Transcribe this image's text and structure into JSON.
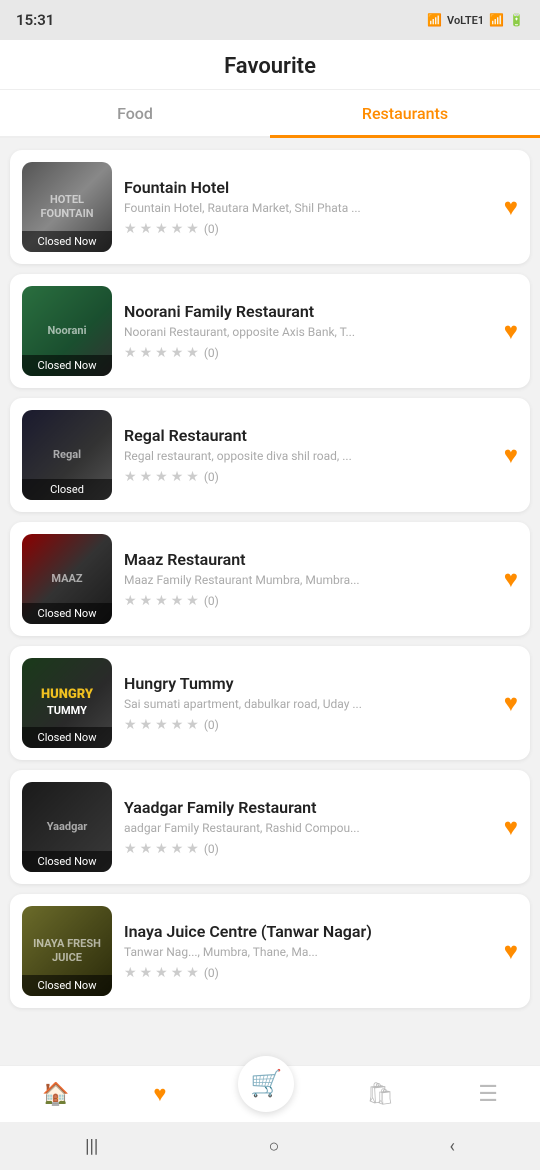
{
  "statusBar": {
    "time": "15:31",
    "icons": "🔔 Vo LTE1 📶 📶 🔋"
  },
  "header": {
    "title": "Favourite"
  },
  "tabs": [
    {
      "id": "food",
      "label": "Food",
      "active": false
    },
    {
      "id": "restaurants",
      "label": "Restaurants",
      "active": true
    }
  ],
  "restaurants": [
    {
      "id": 1,
      "name": "Fountain Hotel",
      "address": "Fountain Hotel, Rautara Market, Shil Phata ...",
      "rating": 0,
      "totalStars": 5,
      "ratingCount": "(0)",
      "status": "Closed Now",
      "imgClass": "img-fountain",
      "imgText": "HOTEL FOUNTAIN"
    },
    {
      "id": 2,
      "name": "Noorani Family Restaurant",
      "address": "Noorani Restaurant, opposite Axis Bank, T...",
      "rating": 0,
      "totalStars": 5,
      "ratingCount": "(0)",
      "status": "Closed Now",
      "imgClass": "img-noorani",
      "imgText": "Noorani"
    },
    {
      "id": 3,
      "name": "Regal Restaurant",
      "address": "Regal restaurant, opposite diva shil road, ...",
      "rating": 0,
      "totalStars": 5,
      "ratingCount": "(0)",
      "status": "Closed",
      "imgClass": "img-regal",
      "imgText": "Regal"
    },
    {
      "id": 4,
      "name": "Maaz Restaurant",
      "address": "Maaz Family Restaurant Mumbra, Mumbra...",
      "rating": 0,
      "totalStars": 5,
      "ratingCount": "(0)",
      "status": "Closed Now",
      "imgClass": "img-maaz",
      "imgText": "MAAZ"
    },
    {
      "id": 5,
      "name": "Hungry Tummy",
      "address": "Sai sumati apartment, dabulkar road, Uday ...",
      "rating": 0,
      "totalStars": 5,
      "ratingCount": "(0)",
      "status": "Closed Now",
      "imgClass": "img-hungry",
      "imgText": "HUNGRY TUMMY"
    },
    {
      "id": 6,
      "name": "Yaadgar Family  Restaurant",
      "address": "aadgar Family Restaurant, Rashid Compou...",
      "rating": 0,
      "totalStars": 5,
      "ratingCount": "(0)",
      "status": "Closed Now",
      "imgClass": "img-yaadgar",
      "imgText": "Yaadgar"
    },
    {
      "id": 7,
      "name": "Inaya Juice Centre (Tanwar Nagar)",
      "address": "Tanwar Nag..., Mumbra, Thane, Ma...",
      "rating": 0,
      "totalStars": 5,
      "ratingCount": "(0)",
      "status": "Closed Now",
      "imgClass": "img-inaya",
      "imgText": "INAYA FRESH JUICE"
    }
  ],
  "bottomNav": {
    "items": [
      {
        "icon": "🏠",
        "label": "home",
        "active": false
      },
      {
        "icon": "♥",
        "label": "favourites",
        "active": true
      },
      {
        "icon": "🛒",
        "label": "cart",
        "active": false,
        "isCenter": true
      },
      {
        "icon": "🛍",
        "label": "orders",
        "active": false
      },
      {
        "icon": "☰",
        "label": "menu",
        "active": false
      }
    ]
  },
  "androidNav": {
    "buttons": [
      "|||",
      "○",
      "‹"
    ]
  }
}
